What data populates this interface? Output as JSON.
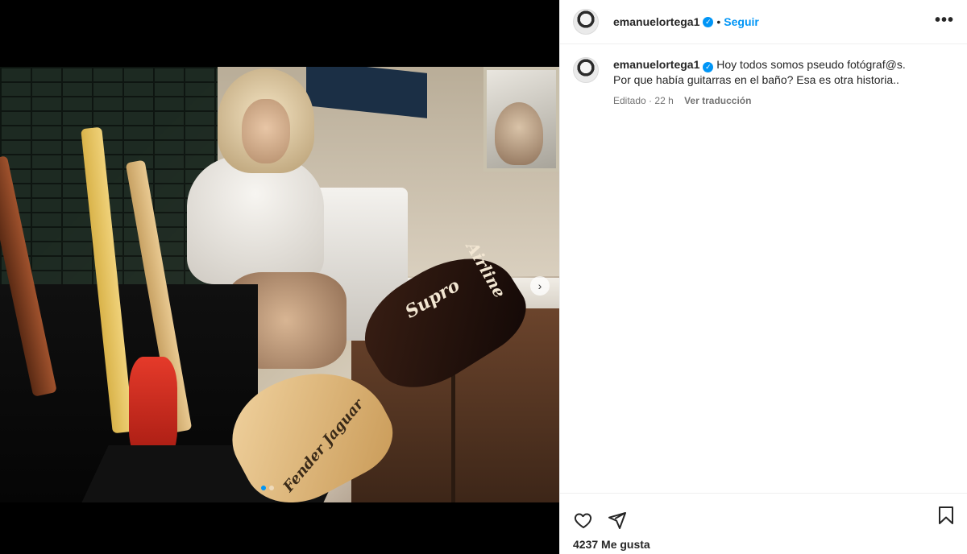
{
  "post": {
    "author": {
      "username": "emanuelortega1",
      "verified": true,
      "follow_label": "Seguir",
      "separator": "•"
    },
    "more_icon": "more-options-icon",
    "caption": {
      "username": "emanuelortega1",
      "line1": "Hoy todos somos pseudo fotógraf@s.",
      "line2": "Por que había guitarras en el baño? Esa es otra historia..",
      "edited_label": "Editado",
      "time": "22 h",
      "meta_separator": "·",
      "translate_label": "Ver traducción"
    },
    "media": {
      "logo_supro": "Supro",
      "logo_airline": "Airline",
      "logo_fender": "Fender Jaguar",
      "carousel_total": 2,
      "carousel_active": 1,
      "next_icon": "chevron-right-icon"
    },
    "actions": {
      "like_icon": "heart-icon",
      "share_icon": "send-icon",
      "save_icon": "bookmark-icon"
    },
    "likes_text": "4237 Me gusta",
    "colors": {
      "accent": "#0095f6",
      "text": "#262626",
      "muted": "#737373",
      "border": "#efefef"
    }
  }
}
